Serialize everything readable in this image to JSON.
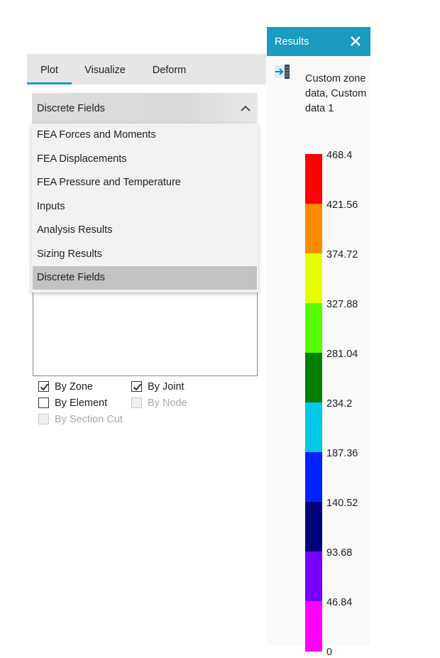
{
  "tabs": [
    {
      "label": "Plot",
      "active": true
    },
    {
      "label": "Visualize",
      "active": false
    },
    {
      "label": "Deform",
      "active": false
    }
  ],
  "combo": {
    "selected": "Discrete Fields"
  },
  "dropdown_items": [
    "FEA Forces and Moments",
    "FEA Displacements",
    "FEA Pressure and Temperature",
    "Inputs",
    "Analysis Results",
    "Sizing Results",
    "Discrete Fields"
  ],
  "checkboxes": {
    "by_zone": {
      "label": "By Zone",
      "checked": true,
      "enabled": true
    },
    "by_joint": {
      "label": "By Joint",
      "checked": true,
      "enabled": true
    },
    "by_element": {
      "label": "By Element",
      "checked": false,
      "enabled": true
    },
    "by_node": {
      "label": "By Node",
      "checked": false,
      "enabled": false
    },
    "by_section_cut": {
      "label": "By Section Cut",
      "checked": false,
      "enabled": false
    }
  },
  "results": {
    "title": "Results",
    "legend_title_lines": [
      "Custom zone",
      "data, Custom",
      "data 1"
    ],
    "legend_colors": [
      "#ff0000",
      "#ff8c00",
      "#e5ff00",
      "#55ff00",
      "#008000",
      "#00c8e6",
      "#0022ff",
      "#000078",
      "#7700ff",
      "#ff00ff"
    ],
    "legend_labels": [
      "468.4",
      "421.56",
      "374.72",
      "327.88",
      "281.04",
      "234.2",
      "187.36",
      "140.52",
      "93.68",
      "46.84",
      "0"
    ]
  },
  "colors": {
    "accent": "#1a9bbf",
    "tab_underline": "#1e9bc4"
  }
}
